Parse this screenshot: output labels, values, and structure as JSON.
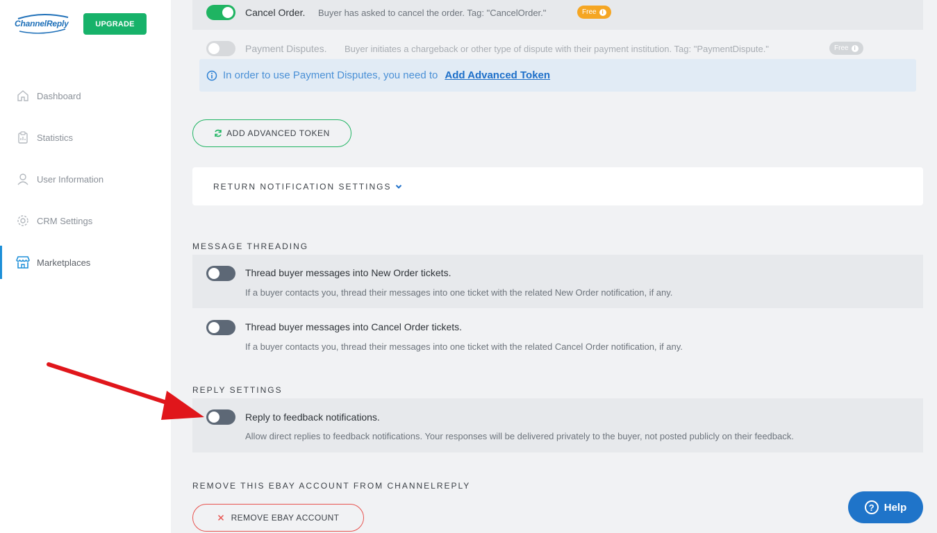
{
  "brand": {
    "logo_text": "ChannelReply",
    "upgrade_label": "UPGRADE"
  },
  "nav": [
    {
      "label": "Dashboard",
      "icon": "home-icon"
    },
    {
      "label": "Statistics",
      "icon": "clipboard-icon"
    },
    {
      "label": "User Information",
      "icon": "user-icon"
    },
    {
      "label": "CRM Settings",
      "icon": "gear-icon"
    },
    {
      "label": "Marketplaces",
      "icon": "store-icon",
      "active": true
    }
  ],
  "notifications": {
    "cancel_order": {
      "title": "Cancel Order.",
      "desc": "Buyer has asked to cancel the order. Tag: \"CancelOrder.\"",
      "badge": "Free",
      "enabled": true
    },
    "payment_disputes": {
      "title": "Payment Disputes.",
      "desc": "Buyer initiates a chargeback or other type of dispute with their payment institution. Tag: \"PaymentDispute.\"",
      "badge": "Free",
      "enabled": false
    },
    "info_text": "In order to use Payment Disputes, you need to",
    "info_link": "Add Advanced Token",
    "add_token_button": "ADD ADVANCED TOKEN"
  },
  "return_settings": {
    "label": "RETURN NOTIFICATION SETTINGS"
  },
  "message_threading": {
    "heading": "MESSAGE THREADING",
    "items": [
      {
        "title": "Thread buyer messages into New Order tickets.",
        "desc": "If a buyer contacts you, thread their messages into one ticket with the related New Order notification, if any.",
        "enabled": false
      },
      {
        "title": "Thread buyer messages into Cancel Order tickets.",
        "desc": "If a buyer contacts you, thread their messages into one ticket with the related Cancel Order notification, if any.",
        "enabled": false
      }
    ]
  },
  "reply_settings": {
    "heading": "REPLY SETTINGS",
    "title": "Reply to feedback notifications.",
    "desc": "Allow direct replies to feedback notifications. Your responses will be delivered privately to the buyer, not posted publicly on their feedback.",
    "enabled": false
  },
  "remove_account": {
    "heading": "REMOVE THIS EBAY ACCOUNT FROM CHANNELREPLY",
    "button": "REMOVE EBAY ACCOUNT"
  },
  "help": {
    "label": "Help"
  },
  "colors": {
    "green": "#1fb462",
    "upgrade": "#17b26a",
    "orange_badge": "#f5a623",
    "link_blue": "#1d6fc9",
    "red": "#e0161b",
    "help_blue": "#1f74c9"
  }
}
